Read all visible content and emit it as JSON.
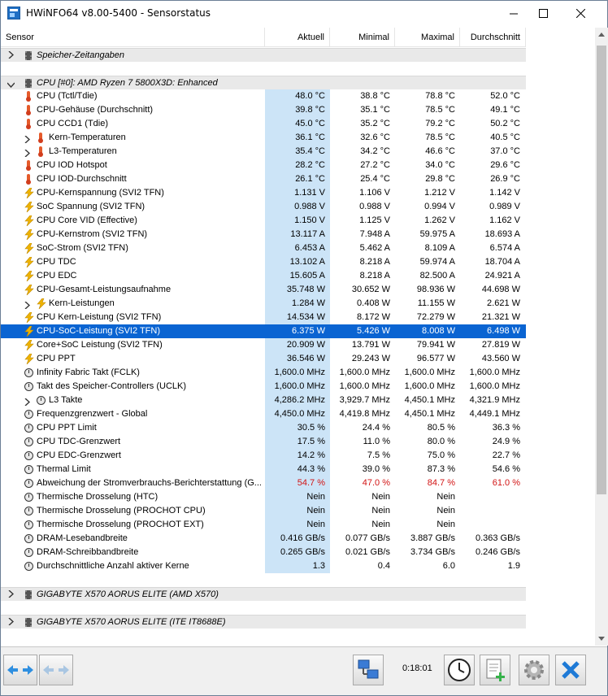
{
  "window": {
    "title": "HWiNFO64 v8.00-5400 - Sensorstatus",
    "controls": [
      "minimize",
      "maximize",
      "close"
    ]
  },
  "columns": [
    "Sensor",
    "Aktuell",
    "Minimal",
    "Maximal",
    "Durchschnitt"
  ],
  "groups": [
    {
      "label": "Speicher-Zeitangaben",
      "expanded": false
    },
    {
      "label": "CPU [#0]: AMD Ryzen 7 5800X3D: Enhanced",
      "expanded": true
    },
    {
      "label": "GIGABYTE X570 AORUS ELITE (AMD X570)",
      "expanded": false
    },
    {
      "label": "GIGABYTE X570 AORUS ELITE (ITE IT8688E)",
      "expanded": false
    }
  ],
  "rows": [
    {
      "name": "CPU (Tctl/Tdie)",
      "icon": "thermometer-icon",
      "cur": "48.0 °C",
      "min": "38.8 °C",
      "max": "78.8 °C",
      "avg": "52.0 °C"
    },
    {
      "name": "CPU-Gehäuse (Durchschnitt)",
      "icon": "thermometer-icon",
      "cur": "39.8 °C",
      "min": "35.1 °C",
      "max": "78.5 °C",
      "avg": "49.1 °C"
    },
    {
      "name": "CPU CCD1 (Tdie)",
      "icon": "thermometer-icon",
      "cur": "45.0 °C",
      "min": "35.2 °C",
      "max": "79.2 °C",
      "avg": "50.2 °C"
    },
    {
      "name": "Kern-Temperaturen",
      "icon": "thermometer-icon",
      "expandable": true,
      "cur": "36.1 °C",
      "min": "32.6 °C",
      "max": "78.5 °C",
      "avg": "40.5 °C"
    },
    {
      "name": "L3-Temperaturen",
      "icon": "thermometer-icon",
      "expandable": true,
      "cur": "35.4 °C",
      "min": "34.2 °C",
      "max": "46.6 °C",
      "avg": "37.0 °C"
    },
    {
      "name": "CPU IOD Hotspot",
      "icon": "thermometer-icon",
      "cur": "28.2 °C",
      "min": "27.2 °C",
      "max": "34.0 °C",
      "avg": "29.6 °C"
    },
    {
      "name": "CPU IOD-Durchschnitt",
      "icon": "thermometer-icon",
      "cur": "26.1 °C",
      "min": "25.4 °C",
      "max": "29.8 °C",
      "avg": "26.9 °C"
    },
    {
      "name": "CPU-Kernspannung (SVI2 TFN)",
      "icon": "lightning-icon",
      "cur": "1.131 V",
      "min": "1.106 V",
      "max": "1.212 V",
      "avg": "1.142 V"
    },
    {
      "name": "SoC Spannung (SVI2 TFN)",
      "icon": "lightning-icon",
      "cur": "0.988 V",
      "min": "0.988 V",
      "max": "0.994 V",
      "avg": "0.989 V"
    },
    {
      "name": "CPU Core VID (Effective)",
      "icon": "lightning-icon",
      "cur": "1.150 V",
      "min": "1.125 V",
      "max": "1.262 V",
      "avg": "1.162 V"
    },
    {
      "name": "CPU-Kernstrom (SVI2 TFN)",
      "icon": "lightning-icon",
      "cur": "13.117 A",
      "min": "7.948 A",
      "max": "59.975 A",
      "avg": "18.693 A"
    },
    {
      "name": "SoC-Strom (SVI2 TFN)",
      "icon": "lightning-icon",
      "cur": "6.453 A",
      "min": "5.462 A",
      "max": "8.109 A",
      "avg": "6.574 A"
    },
    {
      "name": "CPU TDC",
      "icon": "lightning-icon",
      "cur": "13.102 A",
      "min": "8.218 A",
      "max": "59.974 A",
      "avg": "18.704 A"
    },
    {
      "name": "CPU EDC",
      "icon": "lightning-icon",
      "cur": "15.605 A",
      "min": "8.218 A",
      "max": "82.500 A",
      "avg": "24.921 A"
    },
    {
      "name": "CPU-Gesamt-Leistungsaufnahme",
      "icon": "lightning-icon",
      "cur": "35.748 W",
      "min": "30.652 W",
      "max": "98.936 W",
      "avg": "44.698 W"
    },
    {
      "name": "Kern-Leistungen",
      "icon": "lightning-icon",
      "expandable": true,
      "cur": "1.284 W",
      "min": "0.408 W",
      "max": "11.155 W",
      "avg": "2.621 W"
    },
    {
      "name": "CPU Kern-Leistung (SVI2 TFN)",
      "icon": "lightning-icon",
      "cur": "14.534 W",
      "min": "8.172 W",
      "max": "72.279 W",
      "avg": "21.321 W"
    },
    {
      "name": "CPU-SoC-Leistung (SVI2 TFN)",
      "icon": "lightning-icon",
      "selected": true,
      "cur": "6.375 W",
      "min": "5.426 W",
      "max": "8.008 W",
      "avg": "6.498 W"
    },
    {
      "name": "Core+SoC Leistung (SVI2 TFN)",
      "icon": "lightning-icon",
      "cur": "20.909 W",
      "min": "13.791 W",
      "max": "79.941 W",
      "avg": "27.819 W"
    },
    {
      "name": "CPU PPT",
      "icon": "lightning-icon",
      "cur": "36.546 W",
      "min": "29.243 W",
      "max": "96.577 W",
      "avg": "43.560 W"
    },
    {
      "name": "Infinity Fabric Takt (FCLK)",
      "icon": "clock-icon",
      "cur": "1,600.0 MHz",
      "min": "1,600.0 MHz",
      "max": "1,600.0 MHz",
      "avg": "1,600.0 MHz"
    },
    {
      "name": "Takt des Speicher-Controllers (UCLK)",
      "icon": "clock-icon",
      "cur": "1,600.0 MHz",
      "min": "1,600.0 MHz",
      "max": "1,600.0 MHz",
      "avg": "1,600.0 MHz"
    },
    {
      "name": "L3 Takte",
      "icon": "clock-icon",
      "expandable": true,
      "cur": "4,286.2 MHz",
      "min": "3,929.7 MHz",
      "max": "4,450.1 MHz",
      "avg": "4,321.9 MHz"
    },
    {
      "name": "Frequenzgrenzwert - Global",
      "icon": "clock-icon",
      "cur": "4,450.0 MHz",
      "min": "4,419.8 MHz",
      "max": "4,450.1 MHz",
      "avg": "4,449.1 MHz"
    },
    {
      "name": "CPU PPT Limit",
      "icon": "clock-icon",
      "cur": "30.5 %",
      "min": "24.4 %",
      "max": "80.5 %",
      "avg": "36.3 %"
    },
    {
      "name": "CPU TDC-Grenzwert",
      "icon": "clock-icon",
      "cur": "17.5 %",
      "min": "11.0 %",
      "max": "80.0 %",
      "avg": "24.9 %"
    },
    {
      "name": "CPU EDC-Grenzwert",
      "icon": "clock-icon",
      "cur": "14.2 %",
      "min": "7.5 %",
      "max": "75.0 %",
      "avg": "22.7 %"
    },
    {
      "name": "Thermal Limit",
      "icon": "clock-icon",
      "cur": "44.3 %",
      "min": "39.0 %",
      "max": "87.3 %",
      "avg": "54.6 %"
    },
    {
      "name": "Abweichung der Stromverbrauchs-Berichterstattung (G...",
      "icon": "clock-icon",
      "red": true,
      "cur": "54.7 %",
      "min": "47.0 %",
      "max": "84.7 %",
      "avg": "61.0 %"
    },
    {
      "name": "Thermische Drosselung (HTC)",
      "icon": "clock-icon",
      "cur": "Nein",
      "min": "Nein",
      "max": "Nein",
      "avg": ""
    },
    {
      "name": "Thermische Drosselung (PROCHOT CPU)",
      "icon": "clock-icon",
      "cur": "Nein",
      "min": "Nein",
      "max": "Nein",
      "avg": ""
    },
    {
      "name": "Thermische Drosselung (PROCHOT EXT)",
      "icon": "clock-icon",
      "cur": "Nein",
      "min": "Nein",
      "max": "Nein",
      "avg": ""
    },
    {
      "name": "DRAM-Lesebandbreite",
      "icon": "clock-icon",
      "cur": "0.416 GB/s",
      "min": "0.077 GB/s",
      "max": "3.887 GB/s",
      "avg": "0.363 GB/s"
    },
    {
      "name": "DRAM-Schreibbandbreite",
      "icon": "clock-icon",
      "cur": "0.265 GB/s",
      "min": "0.021 GB/s",
      "max": "3.734 GB/s",
      "avg": "0.246 GB/s"
    },
    {
      "name": "Durchschnittliche Anzahl aktiver Kerne",
      "icon": "clock-icon",
      "cur": "1.3",
      "min": "0.4",
      "max": "6.0",
      "avg": "1.9"
    }
  ],
  "toolbar": {
    "timer": "0:18:01",
    "buttons": [
      "navigate-both-icon",
      "navigate-disabled-icon",
      "network-icon",
      "clock-reset-icon",
      "add-report-icon",
      "settings-icon",
      "close-x-icon"
    ]
  },
  "colors": {
    "selection": "#0a64d2",
    "current_column": "#cce4f7",
    "warning_text": "#d21414"
  }
}
